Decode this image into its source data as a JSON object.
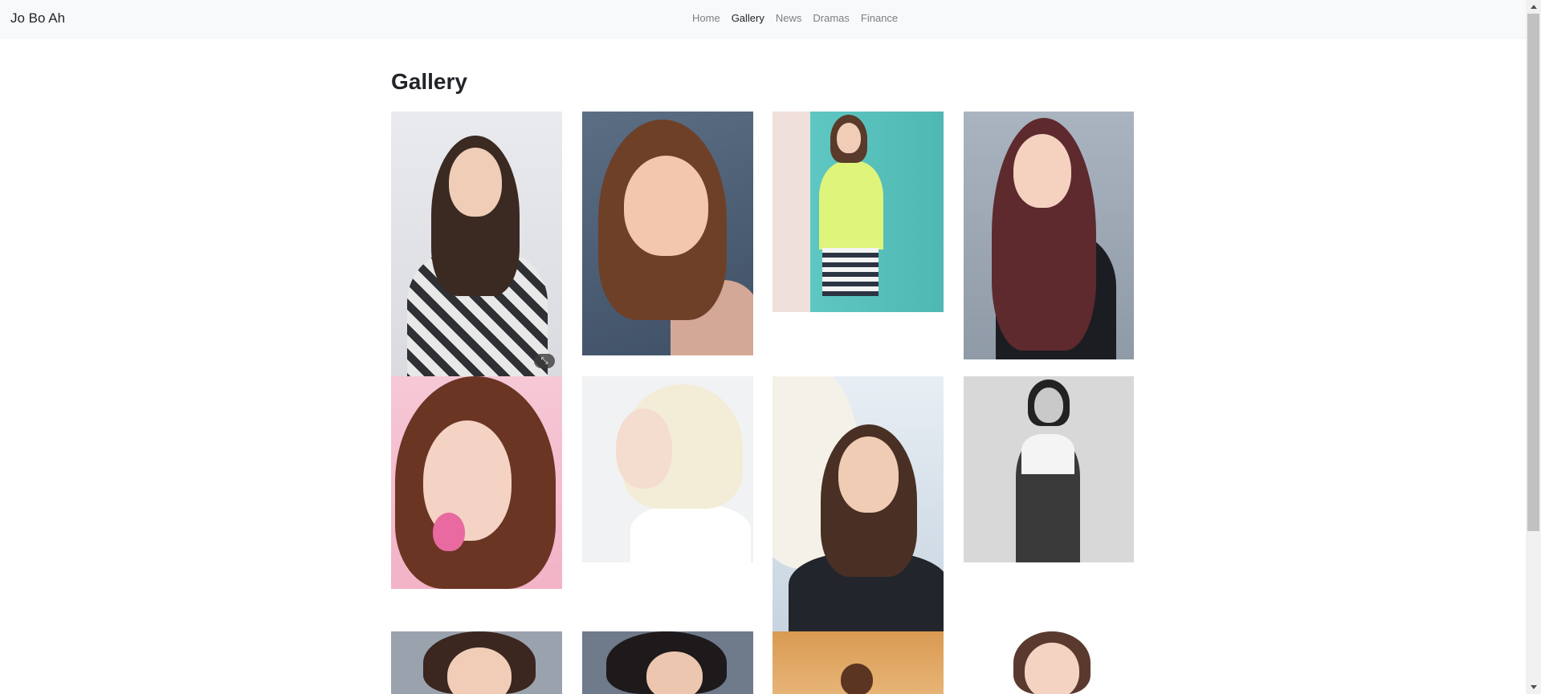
{
  "brand": "Jo Bo Ah",
  "nav": {
    "items": [
      {
        "label": "Home",
        "active": false
      },
      {
        "label": "Gallery",
        "active": true
      },
      {
        "label": "News",
        "active": false
      },
      {
        "label": "Dramas",
        "active": false
      },
      {
        "label": "Finance",
        "active": false
      }
    ]
  },
  "page_title": "Gallery",
  "gallery": {
    "photos": [
      {
        "description": "portrait-floral-top"
      },
      {
        "description": "portrait-winking"
      },
      {
        "description": "portrait-lime-rashguard"
      },
      {
        "description": "portrait-long-red-hair"
      },
      {
        "description": "portrait-pink-flower"
      },
      {
        "description": "portrait-platinum-bob"
      },
      {
        "description": "portrait-sun-hat"
      },
      {
        "description": "portrait-black-white-outfit"
      },
      {
        "description": "portrait-row3-1"
      },
      {
        "description": "portrait-row3-2"
      },
      {
        "description": "portrait-row3-3"
      },
      {
        "description": "portrait-row3-4"
      }
    ]
  },
  "colors": {
    "navbar_bg": "#f8f9fa",
    "nav_active": "#212529",
    "nav_inactive": "#7a7f85"
  }
}
